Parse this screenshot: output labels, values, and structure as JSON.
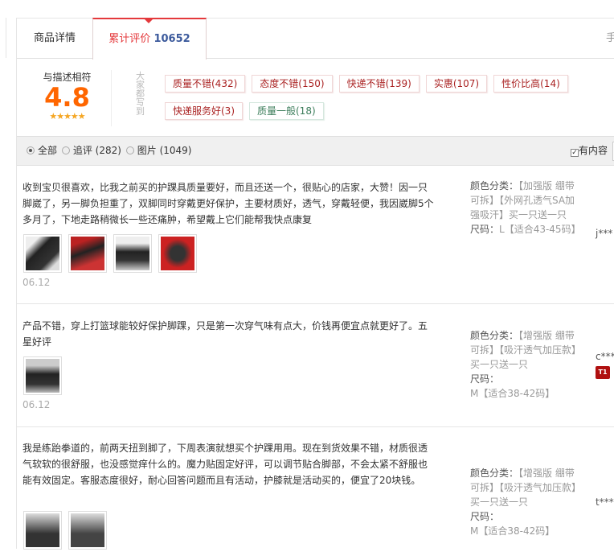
{
  "tabs": {
    "details": "商品详情",
    "reviews_label": "累计评价",
    "reviews_count": "10652",
    "mobile": "手机"
  },
  "rating": {
    "label": "与描述相符",
    "score": "4.8",
    "stars": "★★★★★",
    "everyone_wrote": "大家都写到"
  },
  "tags": [
    {
      "text": "质量不错(432)",
      "type": "pos"
    },
    {
      "text": "态度不错(150)",
      "type": "pos"
    },
    {
      "text": "快递不错(139)",
      "type": "pos"
    },
    {
      "text": "实惠(107)",
      "type": "pos"
    },
    {
      "text": "性价比高(14)",
      "type": "pos"
    },
    {
      "text": "快递服务好(3)",
      "type": "pos"
    },
    {
      "text": "质量一般(18)",
      "type": "neu"
    }
  ],
  "filter": {
    "all": "全部",
    "followup": "追评 (282)",
    "pictures": "图片 (1049)",
    "has_content": "有内容"
  },
  "reviews": [
    {
      "text": "收到宝贝很喜欢，比我之前买的护踝具质量要好，而且还送一个，很贴心的店家，大赞！因一只脚崴了，另一脚负担重了，双脚同时穿戴更好保护，主要材质好，透气，穿戴轻便，我因崴脚5个多月了，下地走路稍微长一些还痛肿，希望戴上它们能帮我快点康复",
      "date": "06.12",
      "color_label": "颜色分类：",
      "color_value": "【加强版 绷带可拆】【外网孔透气SA加强吸汗】买一只送一只",
      "size_label": "尺码：",
      "size_value": "L【适合43-45码】",
      "user": "j***"
    },
    {
      "text": "产品不错，穿上打篮球能较好保护脚踝，只是第一次穿气味有点大，价钱再便宜点就更好了。五星好评",
      "date": "06.12",
      "color_label": "颜色分类：",
      "color_value": "【增强版 绷带可拆】【吸汗透气加压款】买一只送一只",
      "size_label": "尺码：",
      "size_value": "M【适合38-42码】",
      "user": "c***",
      "badge": "T1"
    },
    {
      "text": "我是练跆拳道的，前两天扭到脚了，下周表演就想买个护踝用用。现在到货效果不错，材质很透气软软的很舒服，也没感觉痒什么的。魔力贴固定好评，可以调节贴合脚部，不会太紧不舒服也能有效固定。客服态度很好，耐心回答问题而且有活动，护膝就是活动买的，便宜了20块钱。",
      "color_label": "颜色分类：",
      "color_value": "【增强版 绷带可拆】【吸汗透气加压款】买一只送一只",
      "size_label": "尺码：",
      "size_value": "M【适合38-42码】",
      "user": "t***"
    }
  ]
}
